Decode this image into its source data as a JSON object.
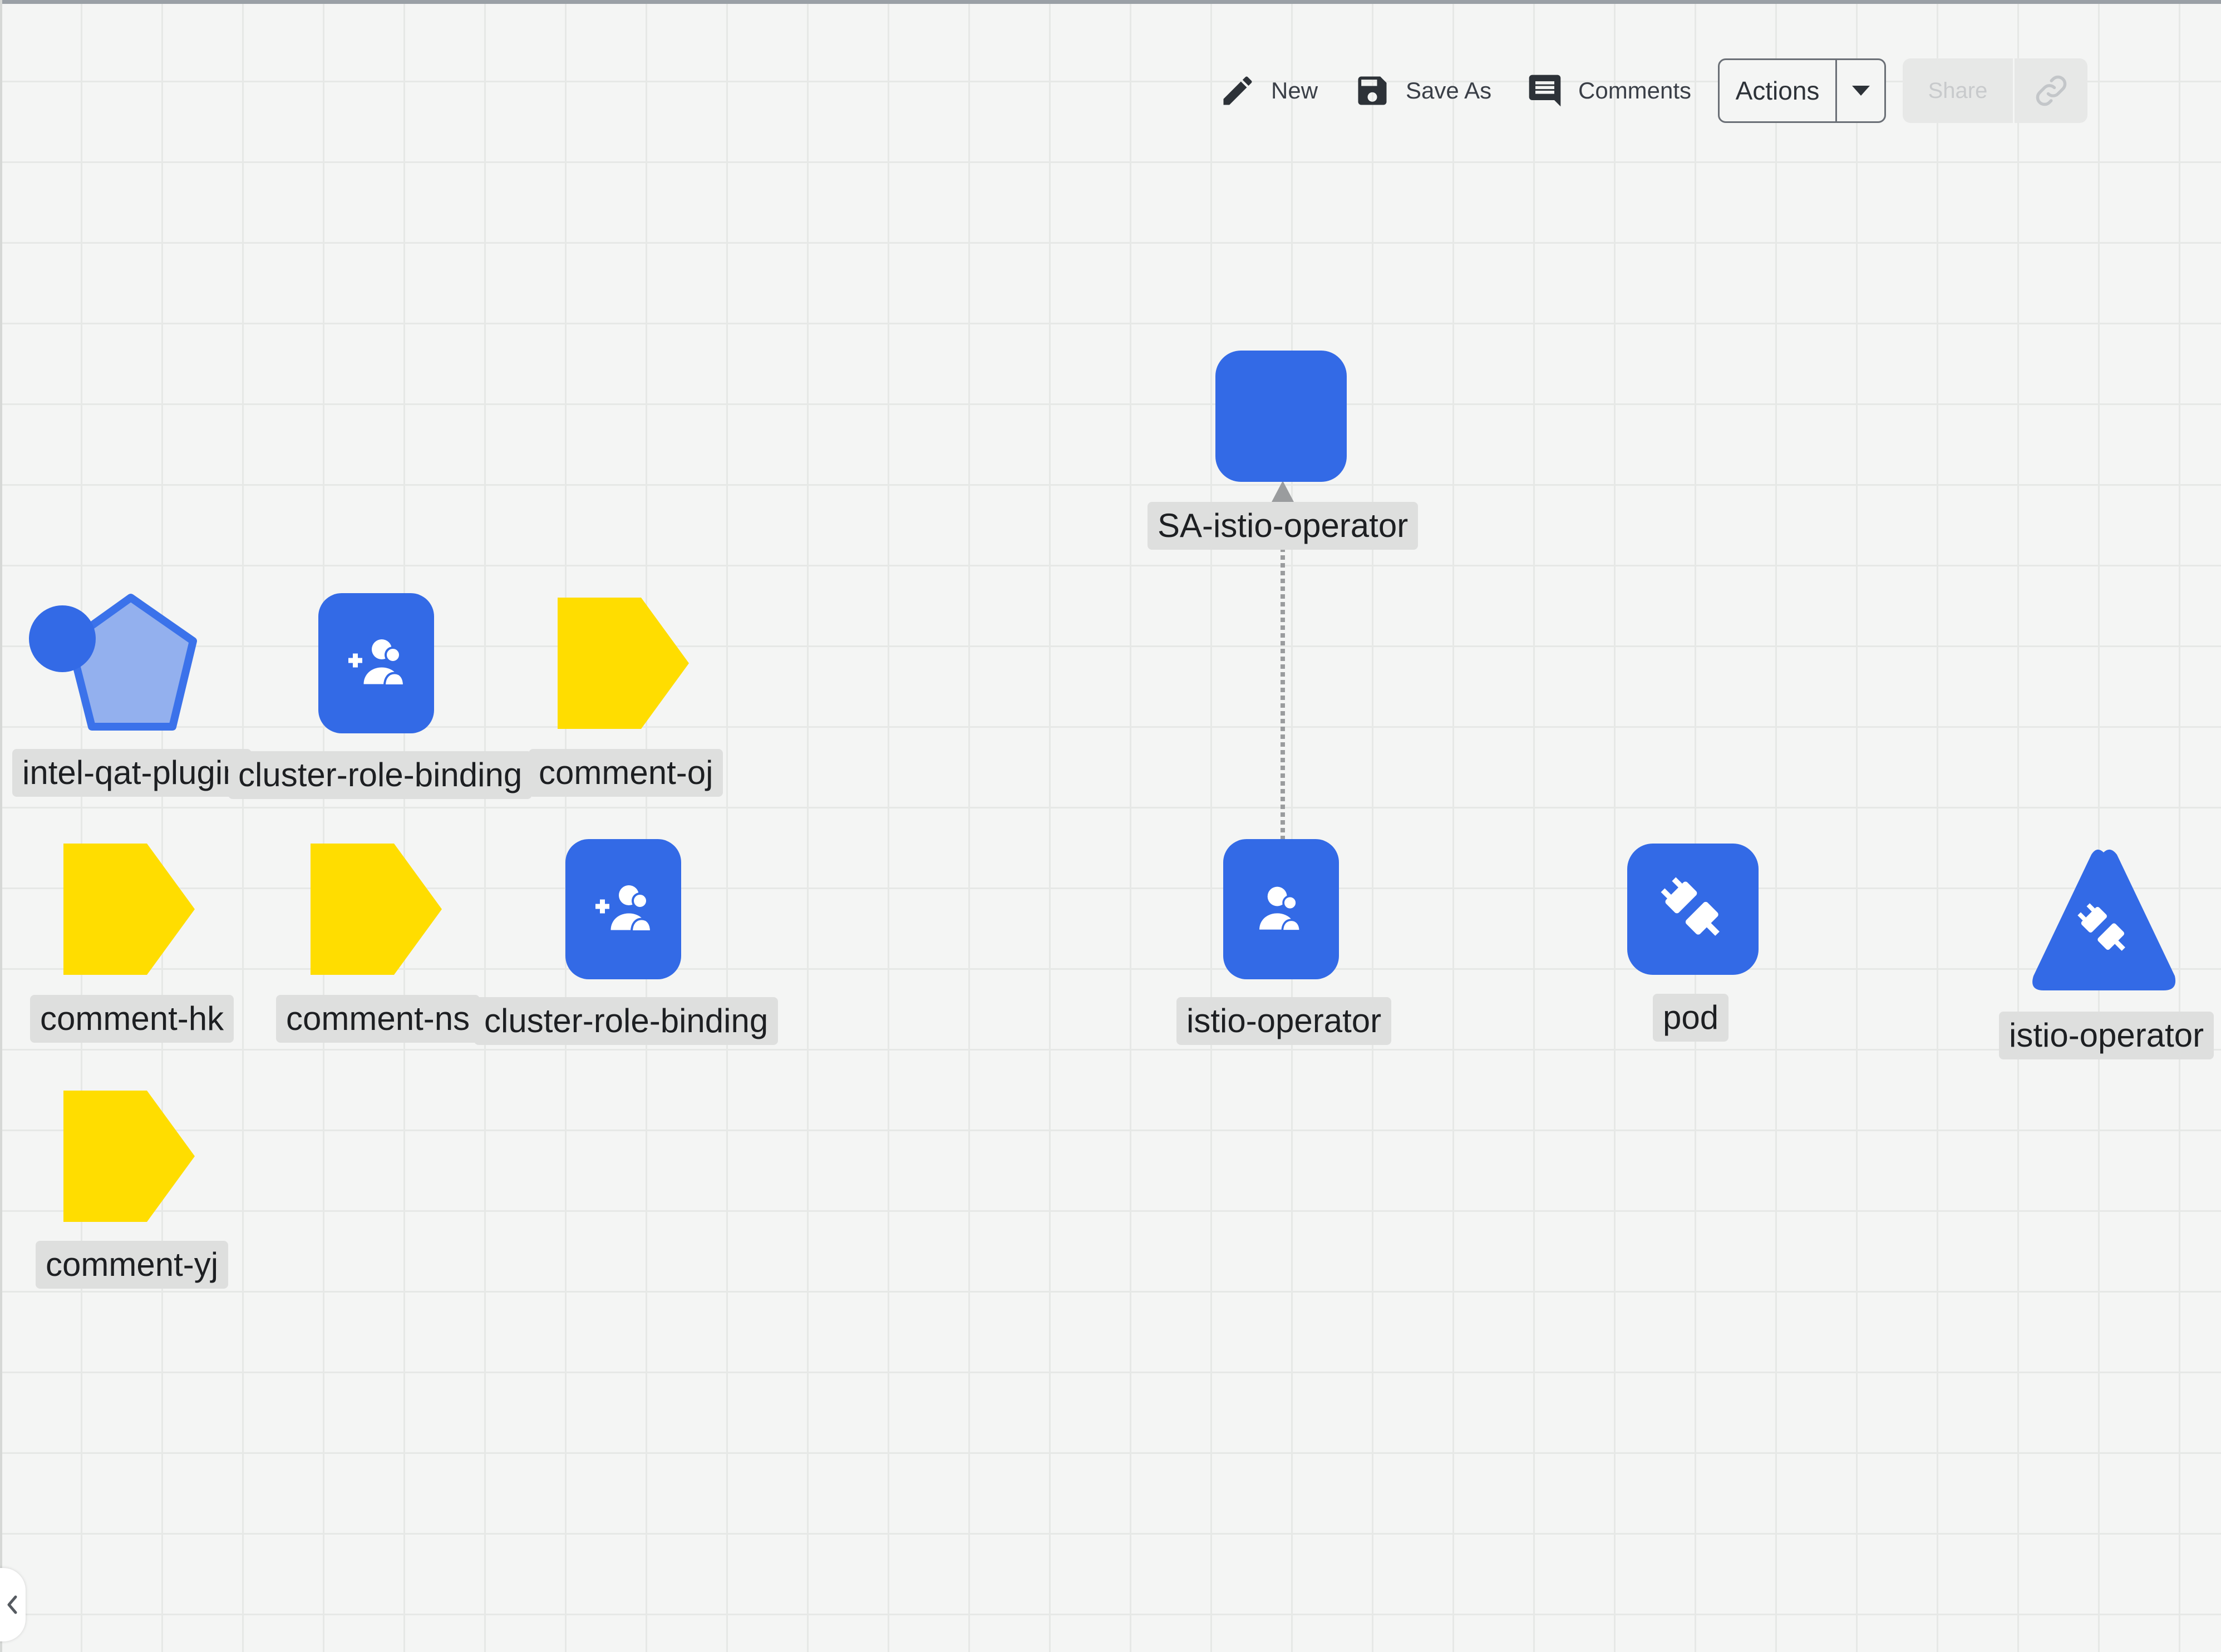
{
  "toolbar": {
    "new_label": "New",
    "save_as_label": "Save As",
    "comments_label": "Comments",
    "actions_label": "Actions",
    "share_label": "Share"
  },
  "nodes": {
    "sa_istio_operator": "SA-istio-operator",
    "intel_qat_plugin": "intel-qat-plugin",
    "cluster_role_binding_1": "cluster-role-binding",
    "comment_oj": "comment-oj",
    "comment_hk": "comment-hk",
    "comment_ns": "comment-ns",
    "cluster_role_binding_2": "cluster-role-binding",
    "istio_operator_sa": "istio-operator",
    "pod": "pod",
    "istio_operator_triangle": "istio-operator",
    "comment_yj": "comment-yj"
  },
  "colors": {
    "node_blue": "#336ae6",
    "comment_yellow": "#ffdd00",
    "pentagon_fill": "#93b0ee",
    "label_bg": "#dedfde",
    "canvas_bg": "#f4f5f4"
  },
  "icons": [
    "pencil-icon",
    "save-icon",
    "comment-icon",
    "caret-down-icon",
    "link-icon",
    "user-add-icon",
    "user-icon",
    "plug-icon",
    "chevron-left-icon"
  ]
}
